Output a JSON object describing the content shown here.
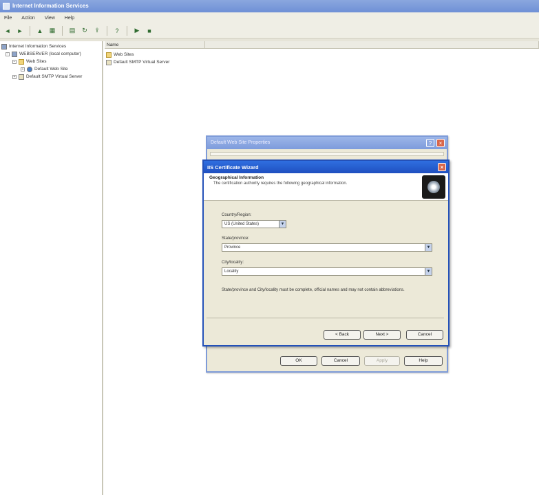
{
  "window": {
    "title": "Internet Information Services"
  },
  "menu": [
    "File",
    "Action",
    "View",
    "Help"
  ],
  "toolbar": [
    {
      "icon": "back-icon",
      "glyph": "◄"
    },
    {
      "icon": "forward-icon",
      "glyph": "►"
    },
    {
      "icon": "up-icon",
      "glyph": "▲"
    },
    {
      "icon": "show-tree-icon",
      "glyph": "▦"
    },
    {
      "icon": "properties-icon",
      "glyph": "▤"
    },
    {
      "icon": "refresh-icon",
      "glyph": "↻"
    },
    {
      "icon": "export-icon",
      "glyph": "⇪"
    },
    {
      "icon": "help-icon",
      "glyph": "?"
    },
    {
      "icon": "play-icon",
      "glyph": "▶"
    },
    {
      "icon": "stop-icon",
      "glyph": "■"
    }
  ],
  "tree": {
    "root": "Internet Information Services",
    "server": "WEBSERVER (local computer)",
    "web_sites": "Web Sites",
    "default_web_site": "Default Web Site",
    "smtp": "Default SMTP Virtual Server"
  },
  "list": {
    "column_name": "Name",
    "rows": [
      "Web Sites",
      "Default SMTP Virtual Server"
    ]
  },
  "properties_dialog": {
    "title": "Default Web Site Properties",
    "ok": "OK",
    "cancel": "Cancel",
    "apply": "Apply",
    "help": "Help"
  },
  "wizard": {
    "title": "IIS Certificate Wizard",
    "header_title": "Geographical Information",
    "header_subtitle": "The certification authority requires the following geographical information.",
    "country_label": "Country/Region:",
    "country_value": "US (United States)",
    "state_label": "State/province:",
    "state_value": "Province",
    "city_label": "City/locality:",
    "city_value": "Locality",
    "note": "State/province and City/locality must be complete, official names and may not contain abbreviations.",
    "back": "< Back",
    "next": "Next >",
    "cancel": "Cancel"
  }
}
